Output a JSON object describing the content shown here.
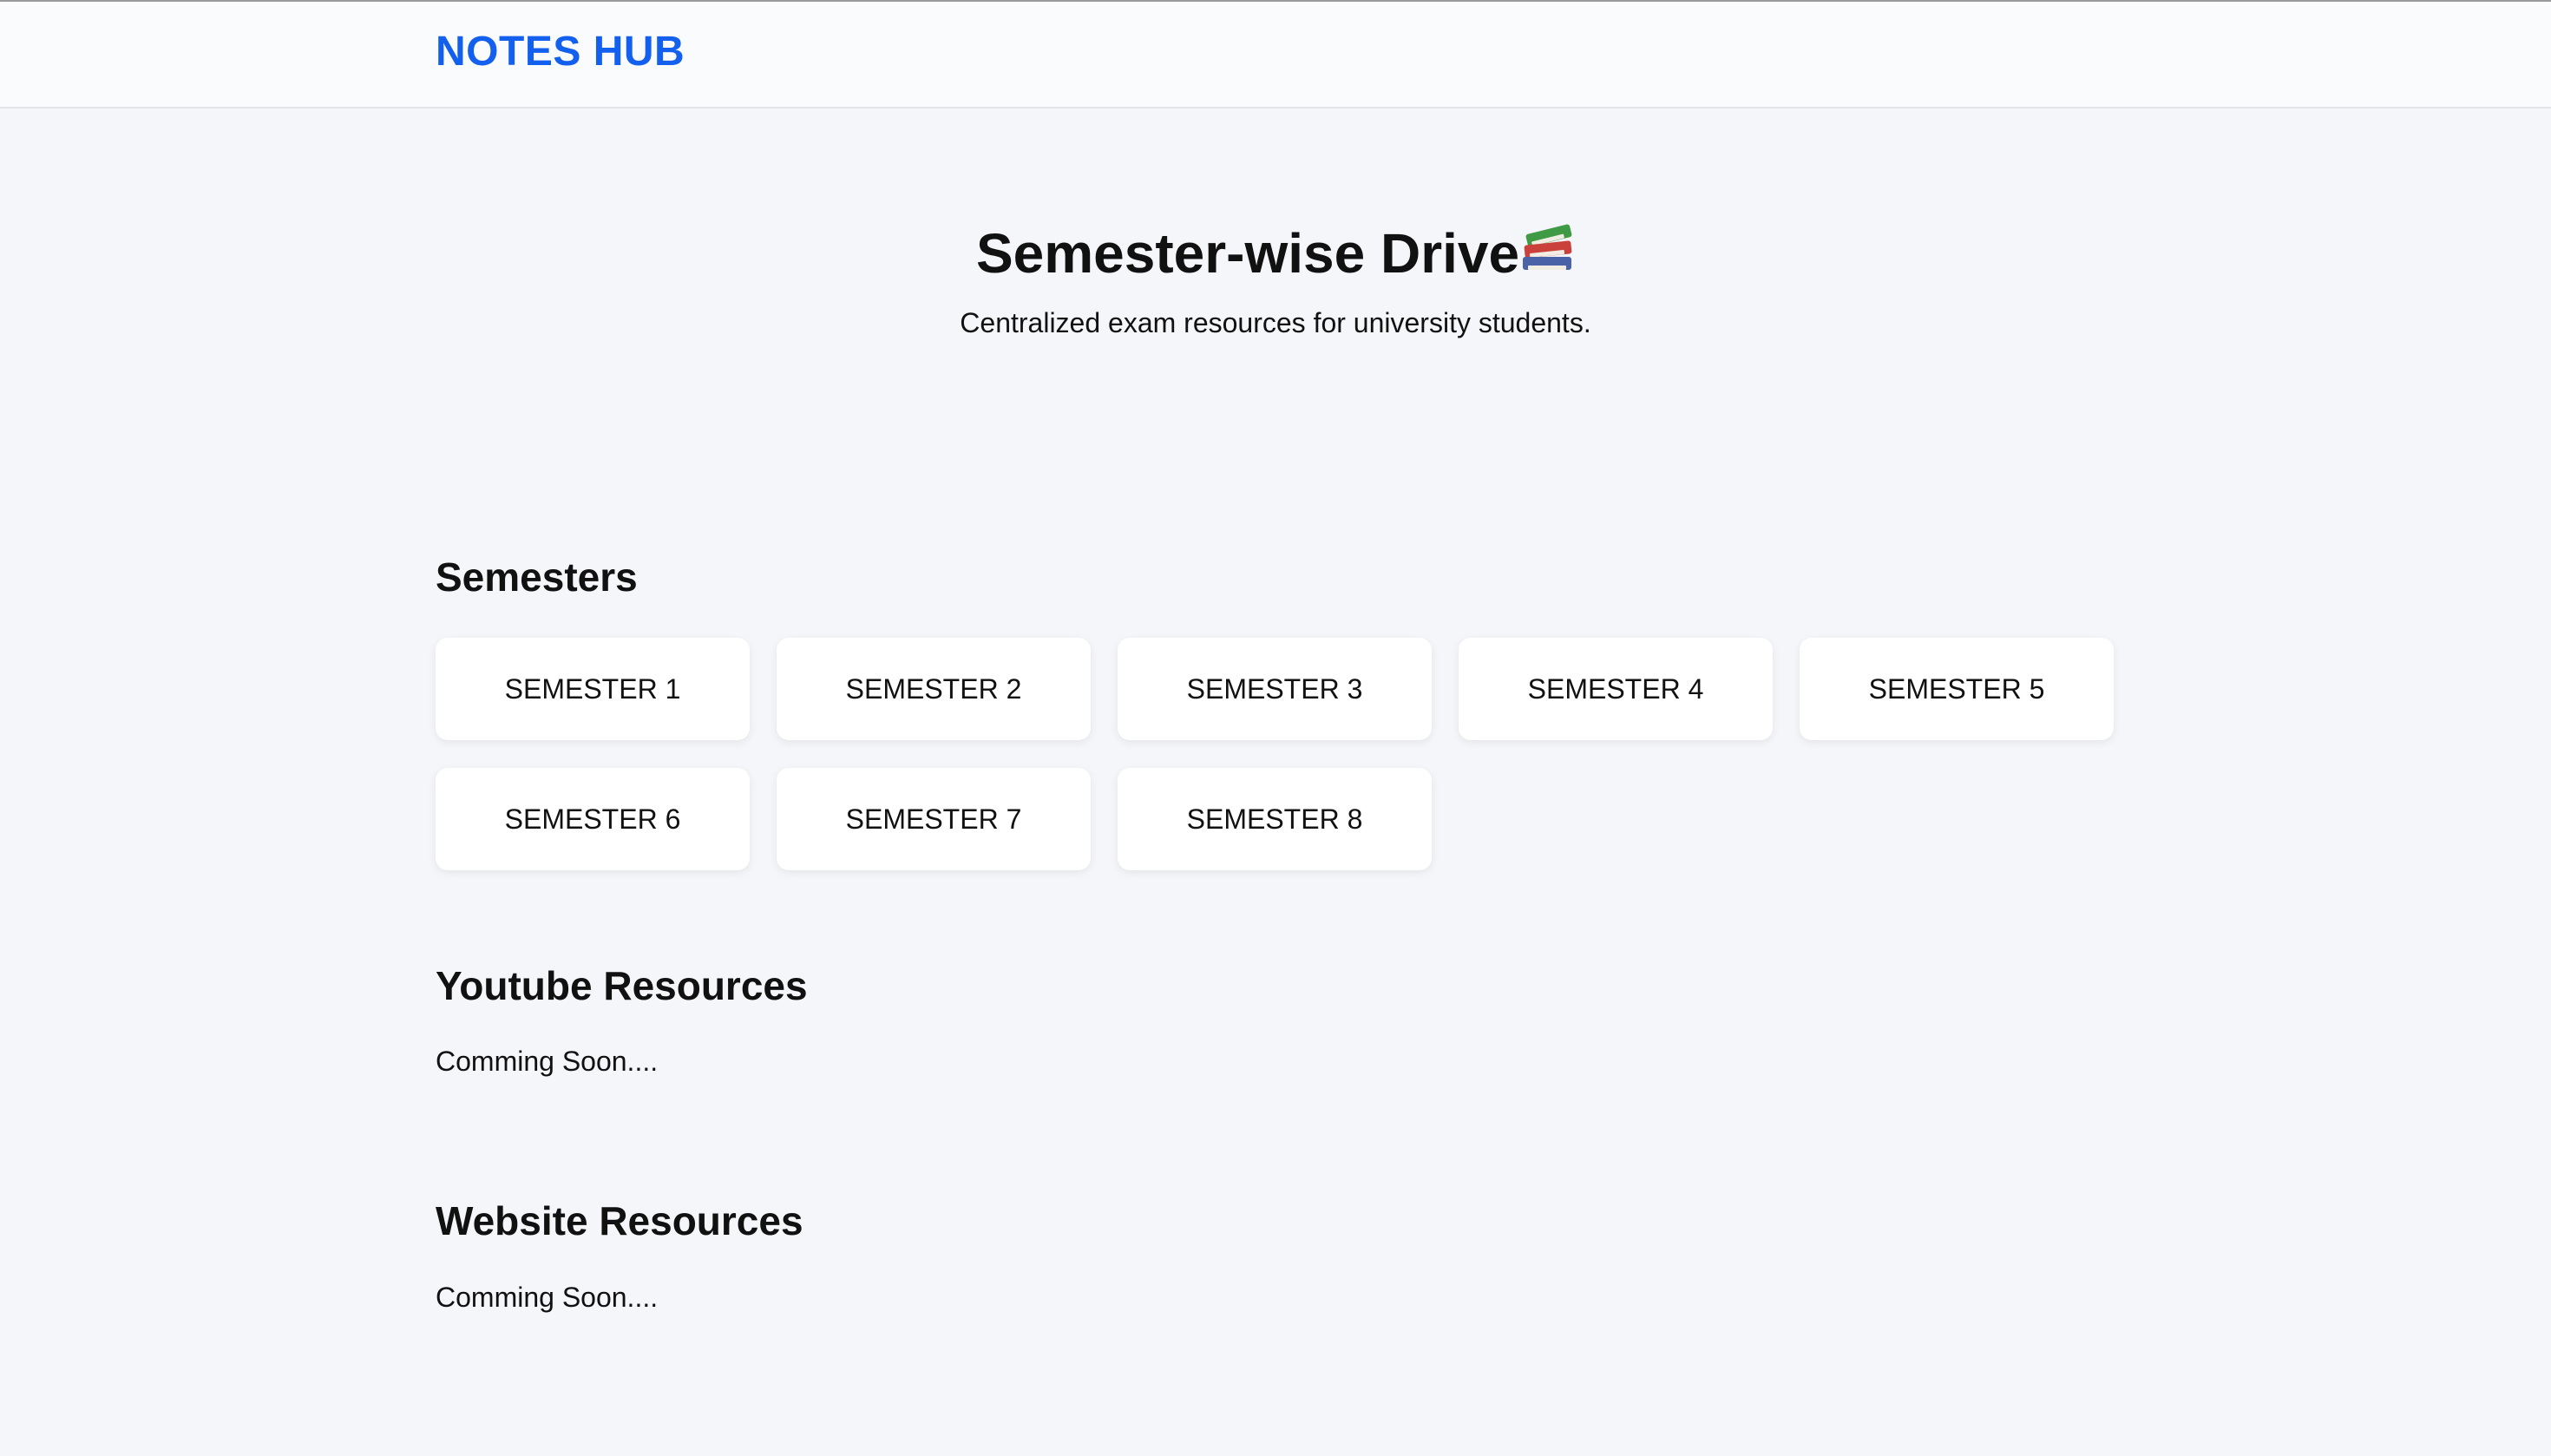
{
  "navbar": {
    "brand": "NOTES HUB",
    "brand_color": "#1360ee"
  },
  "hero": {
    "title": "Semester-wise Drive",
    "title_icon": "books-icon",
    "subtitle": "Centralized exam resources for university students."
  },
  "semesters": {
    "title": "Semesters",
    "items": [
      {
        "label": "SEMESTER 1"
      },
      {
        "label": "SEMESTER 2"
      },
      {
        "label": "SEMESTER 3"
      },
      {
        "label": "SEMESTER 4"
      },
      {
        "label": "SEMESTER 5"
      },
      {
        "label": "SEMESTER 6"
      },
      {
        "label": "SEMESTER 7"
      },
      {
        "label": "SEMESTER 8"
      }
    ]
  },
  "youtube": {
    "title": "Youtube Resources",
    "text": "Comming Soon...."
  },
  "website": {
    "title": "Website Resources",
    "text": "Comming Soon...."
  }
}
